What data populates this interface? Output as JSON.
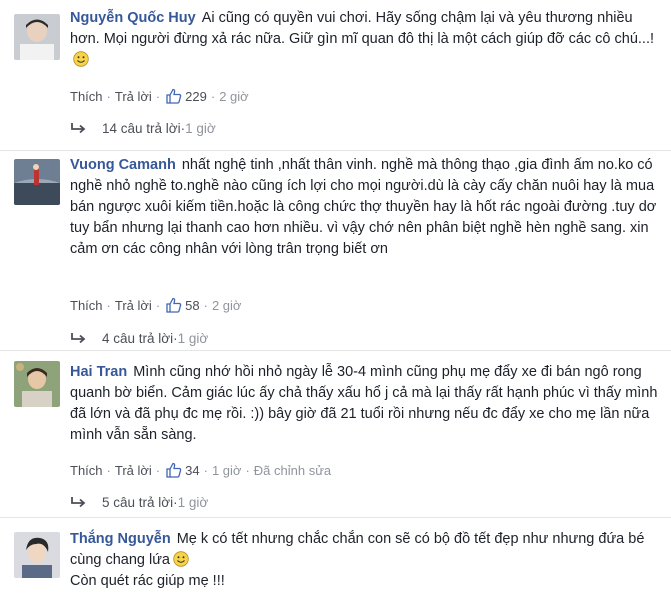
{
  "comments": [
    {
      "author": "Nguyễn Quốc Huy",
      "text": "Ai cũng có quyền vui chơi. Hãy sống chậm lại và yêu thương nhiều hơn. Mọi người đừng xả rác nữa. Giữ gìn mĩ quan đô thị là một cách giúp đỡ các cô chú...!",
      "like": "Thích",
      "reply": "Trả lời",
      "likes": "229",
      "time": "2 giờ",
      "replies": "14 câu trả lời",
      "replies_time": "1 giờ"
    },
    {
      "author": "Vuong Camanh",
      "text": "nhất nghệ tinh ,nhất thân vinh. nghề mà thông thạo ,gia đình ấm no.ko có nghề nhỏ nghề to.nghề nào cũng ích lợi cho mọi người.dù là cày cấy chăn nuôi hay là mua bán ngược xuôi kiếm tiền.hoặc là công chức thợ thuyền hay là hốt rác ngoài đường .tuy dơ tuy bẩn nhưng lại thanh cao hơn nhiều. vì vậy chớ nên phân biệt nghề hèn nghề sang. xin cảm ơn các công nhân với lòng trân trọng biết ơn",
      "like": "Thích",
      "reply": "Trả lời",
      "likes": "58",
      "time": "2 giờ",
      "replies": "4 câu trả lời",
      "replies_time": "1 giờ"
    },
    {
      "author": "Hai Tran",
      "text": "Mình cũng nhớ hồi nhỏ ngày lễ 30-4 mình cũng phụ mẹ đẩy xe đi bán ngô rong quanh bờ biển. Cảm giác lúc ấy chả thấy xấu hổ j cả mà lại thấy rất hạnh phúc vì thấy mình đã lớn và đã phụ đc mẹ rồi. :)) bây giờ đã 21 tuổi rồi nhưng nếu đc đẩy xe cho mẹ lần nữa mình vẫn sẵn sàng.",
      "like": "Thích",
      "reply": "Trả lời",
      "likes": "34",
      "time": "1 giờ",
      "edited": "Đã chỉnh sửa",
      "replies": "5 câu trả lời",
      "replies_time": "1 giờ"
    },
    {
      "author": "Thắng Nguyễn",
      "text_line1": "Mẹ k có tết nhưng chắc chắn con sẽ có bộ đồ tết đẹp như nhưng đứa bé cùng chang lứa",
      "text_line2": "Còn quét rác giúp mẹ !!!"
    }
  ],
  "colors": {
    "author": "#365899",
    "meta": "#90949c",
    "text": "#1d2129"
  }
}
